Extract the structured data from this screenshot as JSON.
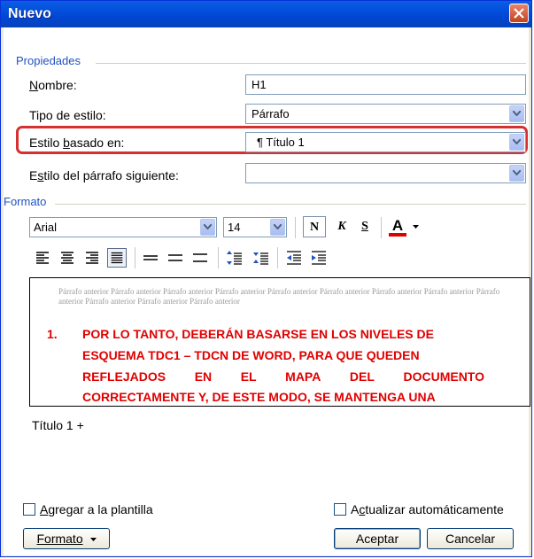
{
  "window": {
    "title": "Nuevo"
  },
  "propiedades": {
    "group_label": "Propiedades",
    "nombre_label": "Nombre:",
    "nombre_value": "H1",
    "tipo_label": "Tipo de estilo:",
    "tipo_value": "Párrafo",
    "basado_label": "Estilo basado en:",
    "basado_value": "¶ Título 1",
    "siguiente_label": "Estilo del párrafo siguiente:",
    "siguiente_value": ""
  },
  "formato": {
    "group_label": "Formato",
    "font": "Arial",
    "size": "14",
    "bold": "N",
    "italic": "K",
    "underline": "S",
    "font_color": "A",
    "font_color_hex": "#e00000"
  },
  "preview": {
    "prev_paragraph": "Párrafo anterior Párrafo anterior Párrafo anterior Párrafo anterior Párrafo anterior Párrafo anterior Párrafo anterior Párrafo anterior Párrafo anterior Párrafo anterior Párrafo anterior Párrafo anterior",
    "number": "1.",
    "lines": [
      [
        "POR LO TANTO, DEBERÁN BASARSE EN LOS NIVELES DE"
      ],
      [
        "ESQUEMA TDC1 – TDCN DE WORD, PARA QUE QUEDEN"
      ],
      [
        "REFLEJADOS",
        "EN",
        "EL",
        "MAPA",
        "DEL",
        "DOCUMENTO"
      ],
      [
        "CORRECTAMENTE Y, DE ESTE MODO, SE MANTENGA UNA"
      ]
    ]
  },
  "description": "Título 1 +",
  "options": {
    "agregar": "Agregar a la plantilla",
    "actualizar": "Actualizar automáticamente"
  },
  "buttons": {
    "formato": "Formato",
    "aceptar": "Aceptar",
    "cancelar": "Cancelar"
  }
}
